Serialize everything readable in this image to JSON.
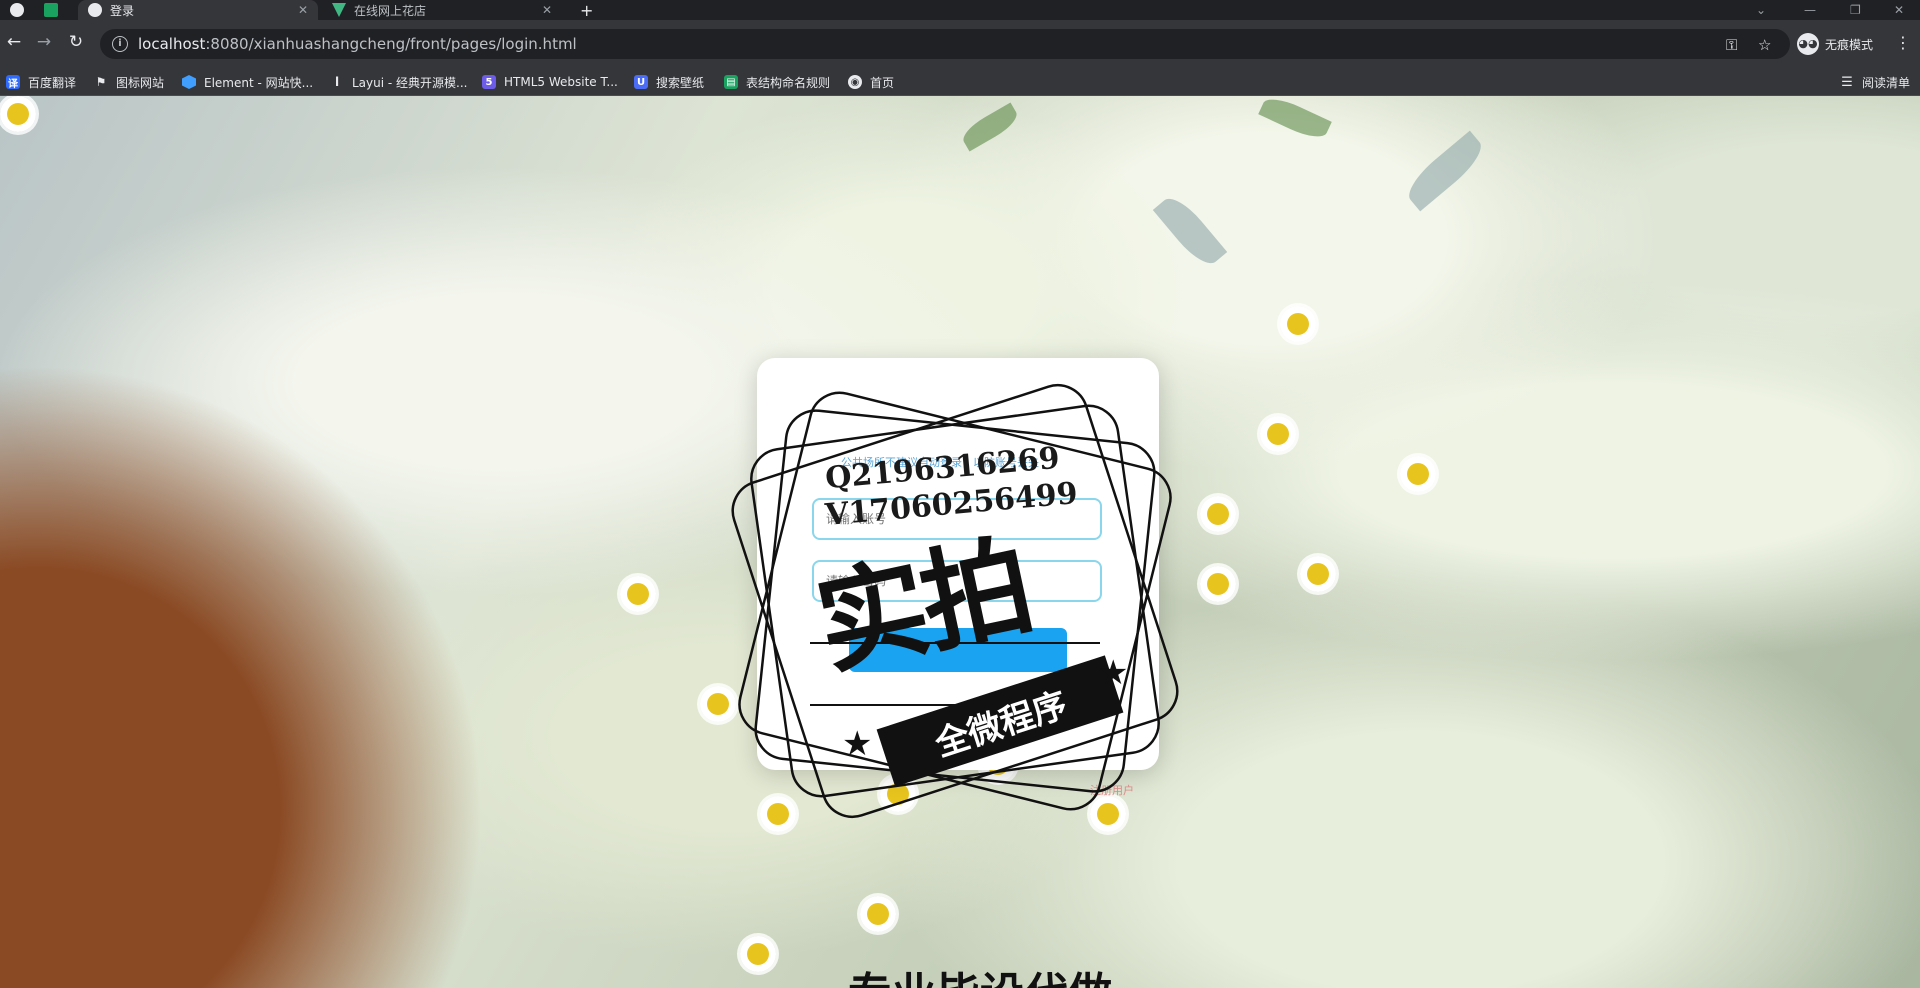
{
  "tabs": [
    {
      "label": "",
      "active": false
    },
    {
      "label": "登录",
      "active": true
    },
    {
      "label": "在线网上花店",
      "active": false
    }
  ],
  "address_bar": {
    "host": "localhost",
    "path": ":8080/xianhuashangcheng/front/pages/login.html"
  },
  "profile": {
    "label": "无痕模式"
  },
  "bookmarks": [
    {
      "label": "百度翻译",
      "icon": "translate-icon",
      "color": "#2f6bff"
    },
    {
      "label": "图标网站",
      "icon": "flag-icon",
      "color": "#e8eaed"
    },
    {
      "label": "Element - 网站快...",
      "icon": "element-icon",
      "color": "#409eff"
    },
    {
      "label": "Layui - 经典开源模...",
      "icon": "layui-icon",
      "color": "#e8eaed"
    },
    {
      "label": "HTML5 Website T...",
      "icon": "html5-icon",
      "color": "#6c5ce7"
    },
    {
      "label": "搜索壁纸",
      "icon": "wallpaper-icon",
      "color": "#4a6cf7"
    },
    {
      "label": "表结构命名规则",
      "icon": "sheet-icon",
      "color": "#1aa260"
    },
    {
      "label": "首页",
      "icon": "globe-icon",
      "color": "#e8eaed"
    }
  ],
  "reading_list": {
    "label": "阅读清单"
  },
  "login": {
    "subtitle": "公共场所不建议自动登录，以防账号丢失",
    "username_placeholder": "请输入账号",
    "password_placeholder": "请输入密码",
    "submit_label": "",
    "register_label": "注册用户"
  },
  "watermark": {
    "line1": "Q2196316269",
    "line2": "V17060256499",
    "big": "实拍",
    "ribbon": "全微程序"
  },
  "bottom_heading": "专业毕设代做"
}
